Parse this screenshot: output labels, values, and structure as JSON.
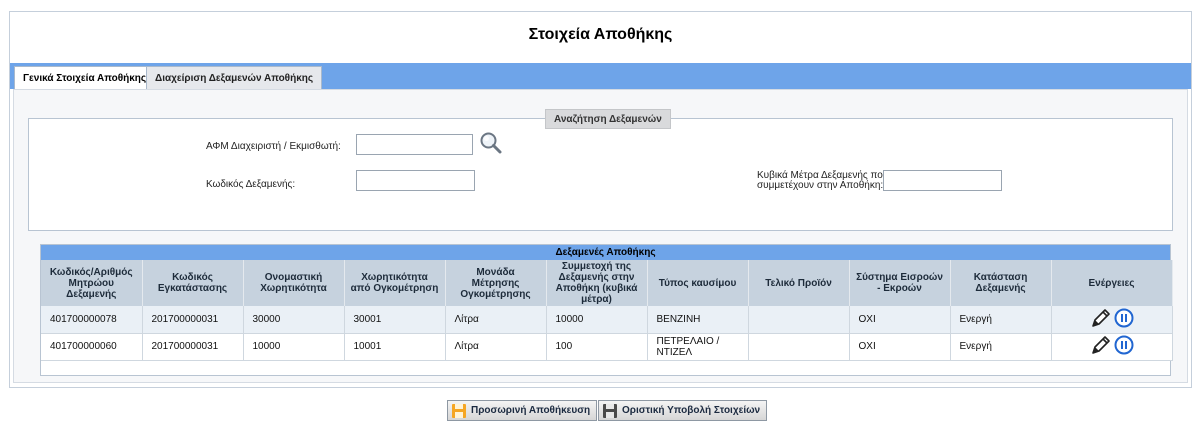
{
  "page_title": "Στοιχεία Αποθήκης",
  "tabs": [
    {
      "label": "Γενικά Στοιχεία Αποθήκης"
    },
    {
      "label": "Διαχείριση Δεξαμενών Αποθήκης"
    }
  ],
  "search": {
    "legend": "Αναζήτηση Δεξαμενών",
    "afm_label": "ΑΦΜ Διαχειριστή / Εκμισθωτή:",
    "afm_value": "",
    "tank_code_label": "Κωδικός Δεξαμενής:",
    "tank_code_value": "",
    "cubic_meters_label_1": "Κυβικά Μέτρα Δεξαμενής που",
    "cubic_meters_label_2": "συμμετέχουν στην Αποθήκη:",
    "cubic_meters_value": "",
    "search_icon": "magnifier-icon"
  },
  "grid": {
    "caption": "Δεξαμενές Αποθήκης",
    "columns": [
      "Κωδικός/Αριθμός Μητρώου Δεξαμενής",
      "Κωδικός Εγκατάστασης",
      "Ονομαστική Χωρητικότητα",
      "Χωρητικότητα από Ογκομέτρηση",
      "Μονάδα Μέτρησης Ογκομέτρησης",
      "Συμμετοχή της Δεξαμενής στην Αποθήκη (κυβικά μέτρα)",
      "Τύπος καυσίμου",
      "Τελικό Προϊόν",
      "Σύστημα Εισροών - Εκροών",
      "Κατάσταση Δεξαμενής",
      "Ενέργειες"
    ],
    "rows": [
      {
        "tank_code": "401700000078",
        "installation_code": "201700000031",
        "nominal_capacity": "30000",
        "measured_capacity": "30001",
        "unit": "Λίτρα",
        "participation": "10000",
        "fuel_type": "ΒΕΝΖΙΝΗ",
        "final_product": "",
        "io_system": "ΟΧΙ",
        "status": "Ενεργή"
      },
      {
        "tank_code": "401700000060",
        "installation_code": "201700000031",
        "nominal_capacity": "10000",
        "measured_capacity": "10001",
        "unit": "Λίτρα",
        "participation": "100",
        "fuel_type": "ΠΕΤΡΕΛΑΙΟ / ΝΤΙΖΕΛ",
        "final_product": "",
        "io_system": "ΟΧΙ",
        "status": "Ενεργή"
      }
    ],
    "action_icons": [
      "pencil-icon",
      "pause-icon"
    ]
  },
  "buttons": {
    "temp_save": "Προσωρινή Αποθήκευση",
    "final_submit": "Οριστική Υποβολή Στοιχείων"
  },
  "colors": {
    "tab_bar": "#6ea4e9",
    "grid_header": "#c6d2de",
    "odd_row": "#eaf0f6",
    "pause_icon": "#2166d1",
    "save_icon_temp": "#f5a623",
    "save_icon_final": "#4a4a4a"
  }
}
